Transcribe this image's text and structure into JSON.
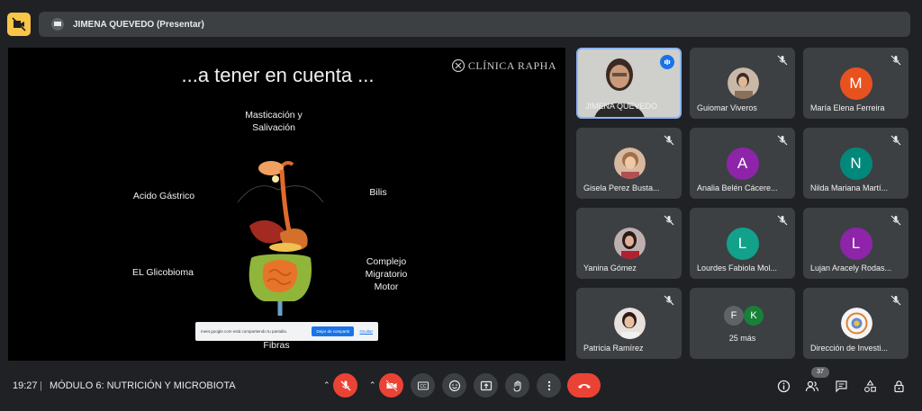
{
  "header": {
    "presenter_label": "JIMENA QUEVEDO (Presentar)"
  },
  "slide": {
    "title": "...a tener en cuenta ...",
    "brand": "CLÍNICA RAPHA",
    "labels": {
      "masticacion": "Masticación y\nSalivación",
      "acido": "Acido Gástrico",
      "bilis": "Bilis",
      "glicobioma": "EL Glicobioma",
      "complejo": "Complejo\nMigratorio\nMotor",
      "fibras": "Fibras"
    },
    "share_bar": {
      "message": "meet.google.com está compartiendo tu pantalla.",
      "stop_label": "Dejar de compartir",
      "hide_label": "Ocultar"
    }
  },
  "participants": [
    {
      "name": "JIMENA QUEVEDO",
      "type": "video",
      "active": true
    },
    {
      "name": "Guiomar Viveros",
      "type": "photo"
    },
    {
      "name": "María Elena Ferreira",
      "type": "letter",
      "letter": "M",
      "color": "#e8521f"
    },
    {
      "name": "Gisela Perez Busta...",
      "type": "photo"
    },
    {
      "name": "Analia Belén Cácere...",
      "type": "letter",
      "letter": "A",
      "color": "#8e24aa"
    },
    {
      "name": "Nilda Mariana Martí...",
      "type": "letter",
      "letter": "N",
      "color": "#00897b"
    },
    {
      "name": "Yanina Gómez",
      "type": "photo"
    },
    {
      "name": "Lourdes Fabiola Mol...",
      "type": "letter",
      "letter": "L",
      "color": "#12a18a"
    },
    {
      "name": "Lujan Aracely Rodas...",
      "type": "letter",
      "letter": "L",
      "color": "#8e24aa"
    },
    {
      "name": "Patricia Ramírez",
      "type": "photo"
    },
    {
      "name": "25 más",
      "type": "more",
      "letters": [
        "F",
        "K"
      ]
    },
    {
      "name": "Dirección de Investi...",
      "type": "logo"
    }
  ],
  "bottom": {
    "time": "19:27",
    "meeting_title": "MÓDULO 6: NUTRICIÓN Y MICROBIOTA",
    "people_count": "37"
  },
  "colors": {
    "background": "#202124",
    "tile": "#3c4043",
    "danger": "#ea4335",
    "accent": "#1a73e8"
  },
  "icons": [
    "camera-off-icon",
    "presentation-icon",
    "mic-off-icon",
    "cc-icon",
    "emoji-icon",
    "present-icon",
    "hand-icon",
    "more-icon",
    "end-call-icon",
    "info-icon",
    "people-icon",
    "chat-icon",
    "activities-icon",
    "host-controls-icon"
  ]
}
